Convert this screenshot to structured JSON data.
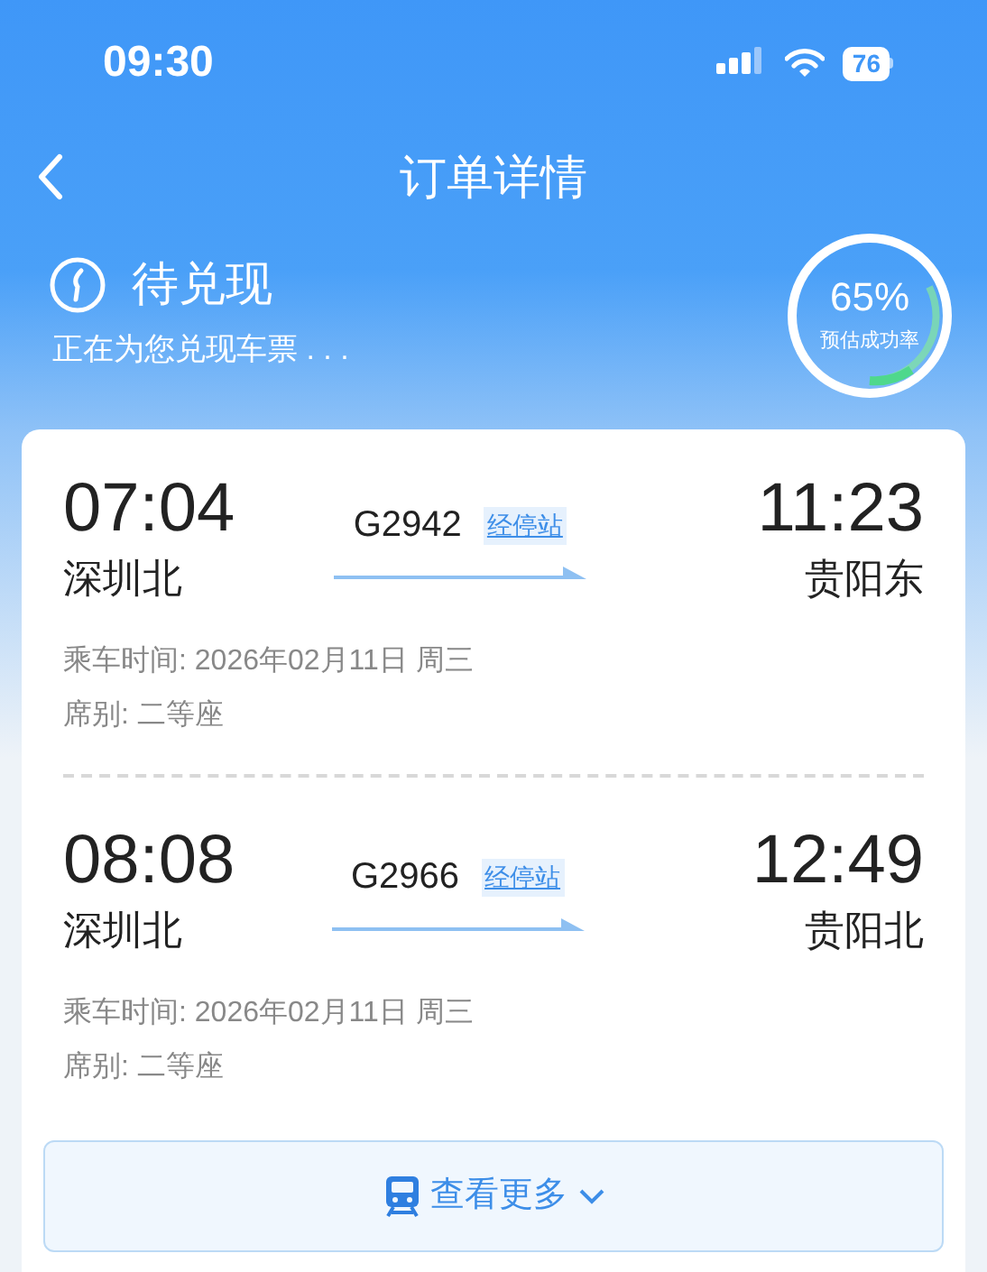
{
  "status_bar": {
    "time": "09:30",
    "battery": "76"
  },
  "nav": {
    "title": "订单详情"
  },
  "order_status": {
    "title": "待兑现",
    "subtitle": "正在为您兑现车票 . . .",
    "rate": "65%",
    "rate_label": "预估成功率"
  },
  "trains": [
    {
      "depart_time": "07:04",
      "depart_station": "深圳北",
      "train_no": "G2942",
      "stops_link": "经停站",
      "arrive_time": "11:23",
      "arrive_station": "贵阳东",
      "date": "乘车时间: 2026年02月11日 周三",
      "seat": "席别: 二等座"
    },
    {
      "depart_time": "08:08",
      "depart_station": "深圳北",
      "train_no": "G2966",
      "stops_link": "经停站",
      "arrive_time": "12:49",
      "arrive_station": "贵阳北",
      "date": "乘车时间: 2026年02月11日 周三",
      "seat": "席别: 二等座"
    }
  ],
  "more_button": {
    "label": "查看更多"
  }
}
